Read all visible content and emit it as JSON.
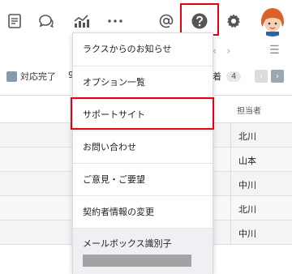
{
  "topbar": {
    "icons": [
      "document-icon",
      "chat-icon",
      "analytics-icon",
      "more-icon",
      "mention-icon",
      "help-icon",
      "gear-icon",
      "avatar"
    ]
  },
  "subbar": {
    "status_label": "対応完了",
    "status_count": "9",
    "right_label": "着",
    "right_badge": "4"
  },
  "table": {
    "assignee_header": "担当者",
    "rows": [
      "北川",
      "山本",
      "中川",
      "北川",
      "中川"
    ]
  },
  "menu": {
    "items": [
      "ラクスからのお知らせ",
      "オプション一覧",
      "サポートサイト",
      "お問い合わせ",
      "ご意見・ご要望",
      "契約者情報の変更",
      "メールボックス識別子"
    ]
  },
  "colors": {
    "highlight": "#e60012",
    "icon": "#555555",
    "menu_border": "#d8dbde"
  }
}
